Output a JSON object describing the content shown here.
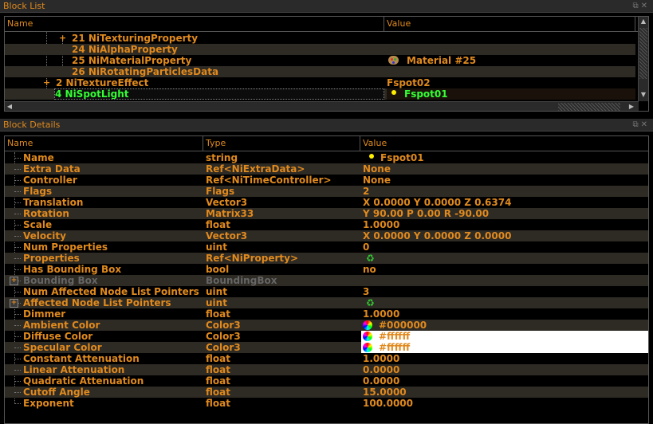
{
  "block_list": {
    "title": "Block List",
    "columns": {
      "name": "Name",
      "value": "Value"
    },
    "rows": [
      {
        "name": "21 NiTexturingProperty",
        "value": ""
      },
      {
        "name": "24 NiAlphaProperty",
        "value": ""
      },
      {
        "name": "25 NiMaterialProperty",
        "value": "Material #25",
        "icon": "palette-icon"
      },
      {
        "name": "26 NiRotatingParticlesData",
        "value": ""
      },
      {
        "name": "2 NiTextureEffect",
        "value": "Fspot02"
      },
      {
        "name": "4 NiSpotLight",
        "value": "Fspot01",
        "icon": "light-bulb-icon",
        "selected": true
      }
    ]
  },
  "block_details": {
    "title": "Block Details",
    "columns": {
      "name": "Name",
      "type": "Type",
      "value": "Value"
    },
    "rows": [
      {
        "name": "Name",
        "type": "string",
        "value": "Fspot01",
        "icon": "light-bulb-icon"
      },
      {
        "name": "Extra Data",
        "type": "Ref<NiExtraData>",
        "value": "None"
      },
      {
        "name": "Controller",
        "type": "Ref<NiTimeController>",
        "value": "None"
      },
      {
        "name": "Flags",
        "type": "Flags",
        "value": "2"
      },
      {
        "name": "Translation",
        "type": "Vector3",
        "value": "X 0.0000 Y 0.0000 Z 0.6374"
      },
      {
        "name": "Rotation",
        "type": "Matrix33",
        "value": "Y 90.00 P 0.00 R -90.00"
      },
      {
        "name": "Scale",
        "type": "float",
        "value": "1.0000"
      },
      {
        "name": "Velocity",
        "type": "Vector3",
        "value": "X 0.0000 Y 0.0000 Z 0.0000"
      },
      {
        "name": "Num Properties",
        "type": "uint",
        "value": "0"
      },
      {
        "name": "Properties",
        "type": "Ref<NiProperty>",
        "value": "",
        "icon": "recycle-icon"
      },
      {
        "name": "Has Bounding Box",
        "type": "bool",
        "value": "no"
      },
      {
        "name": "Bounding Box",
        "type": "BoundingBox",
        "value": "",
        "disabled": true,
        "expandable": true
      },
      {
        "name": "Num Affected Node List Pointers",
        "type": "uint",
        "value": "3"
      },
      {
        "name": "Affected Node List Pointers",
        "type": "uint",
        "value": "",
        "icon": "recycle-icon",
        "expandable": true
      },
      {
        "name": "Dimmer",
        "type": "float",
        "value": "1.0000"
      },
      {
        "name": "Ambient Color",
        "type": "Color3",
        "value": "#000000",
        "icon": "color-wheel-icon"
      },
      {
        "name": "Diffuse Color",
        "type": "Color3",
        "value": "#ffffff",
        "icon": "color-wheel-icon",
        "swatch": "#ffffff"
      },
      {
        "name": "Specular Color",
        "type": "Color3",
        "value": "#ffffff",
        "icon": "color-wheel-icon",
        "swatch": "#ffffff"
      },
      {
        "name": "Constant Attenuation",
        "type": "float",
        "value": "1.0000"
      },
      {
        "name": "Linear Attenuation",
        "type": "float",
        "value": "0.0000"
      },
      {
        "name": "Quadratic Attenuation",
        "type": "float",
        "value": "0.0000"
      },
      {
        "name": "Cutoff Angle",
        "type": "float",
        "value": "15.0000"
      },
      {
        "name": "Exponent",
        "type": "float",
        "value": "100.0000"
      }
    ]
  },
  "colors": {
    "text": "#e08a1e",
    "selected_text": "#33ff33",
    "alt_row": "#2e2a24",
    "disabled": "#666666"
  }
}
